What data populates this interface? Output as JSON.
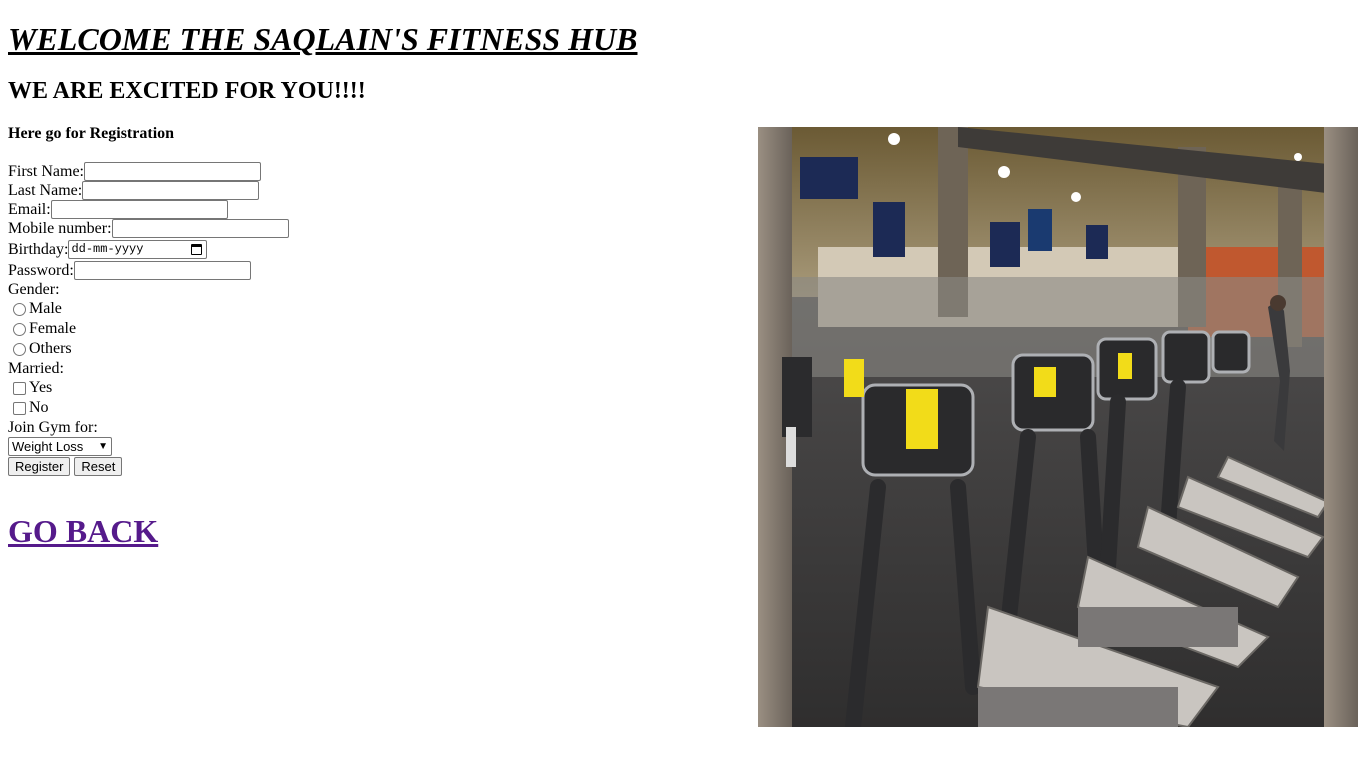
{
  "heading": {
    "title": "WELCOME THE SAQLAIN'S FITNESS HUB",
    "subtitle": "WE ARE EXCITED FOR YOU!!!!",
    "section": "Here go for Registration"
  },
  "form": {
    "first_name_label": "First Name:",
    "last_name_label": "Last Name:",
    "email_label": "Email:",
    "mobile_label": "Mobile number:",
    "birthday_label": "Birthday:",
    "birthday_placeholder": "dd-mm-yyyy",
    "password_label": "Password:",
    "gender_label": "Gender:",
    "gender_options": [
      "Male",
      "Female",
      "Others"
    ],
    "married_label": "Married:",
    "married_options": [
      "Yes",
      "No"
    ],
    "join_label": "Join Gym for:",
    "join_selected": "Weight Loss",
    "register_label": "Register",
    "reset_label": "Reset"
  },
  "link": {
    "go_back": "GO BACK"
  },
  "image": {
    "alt": "gym treadmill room"
  }
}
